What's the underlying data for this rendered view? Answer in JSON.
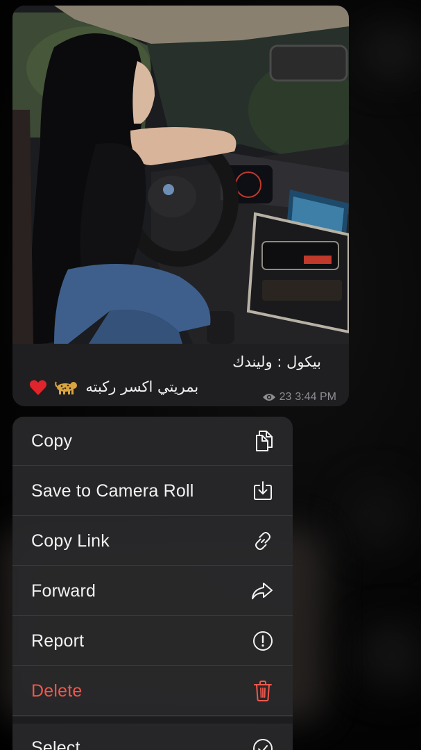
{
  "message": {
    "caption_line1": "بيكول : وليندك",
    "caption_line2": "بمريتي اكسر ركبته",
    "views": "23",
    "time": "3:44 PM",
    "icons": {
      "views": "eye-icon",
      "emoji_1": "leopard-emoji",
      "emoji_2": "red-heart-emoji"
    }
  },
  "context_menu": {
    "items": [
      {
        "label": "Copy",
        "icon": "copy-icon",
        "destructive": false
      },
      {
        "label": "Save to Camera Roll",
        "icon": "download-icon",
        "destructive": false
      },
      {
        "label": "Copy Link",
        "icon": "link-icon",
        "destructive": false
      },
      {
        "label": "Forward",
        "icon": "forward-arrow-icon",
        "destructive": false
      },
      {
        "label": "Report",
        "icon": "exclamation-circle-icon",
        "destructive": false
      },
      {
        "label": "Delete",
        "icon": "trash-icon",
        "destructive": true
      },
      {
        "label": "Select",
        "icon": "checkmark-circle-icon",
        "destructive": false
      }
    ]
  },
  "colors": {
    "destructive": "#f0574b",
    "menu_text": "#f2f2f2",
    "meta_text": "#8d8d92"
  }
}
